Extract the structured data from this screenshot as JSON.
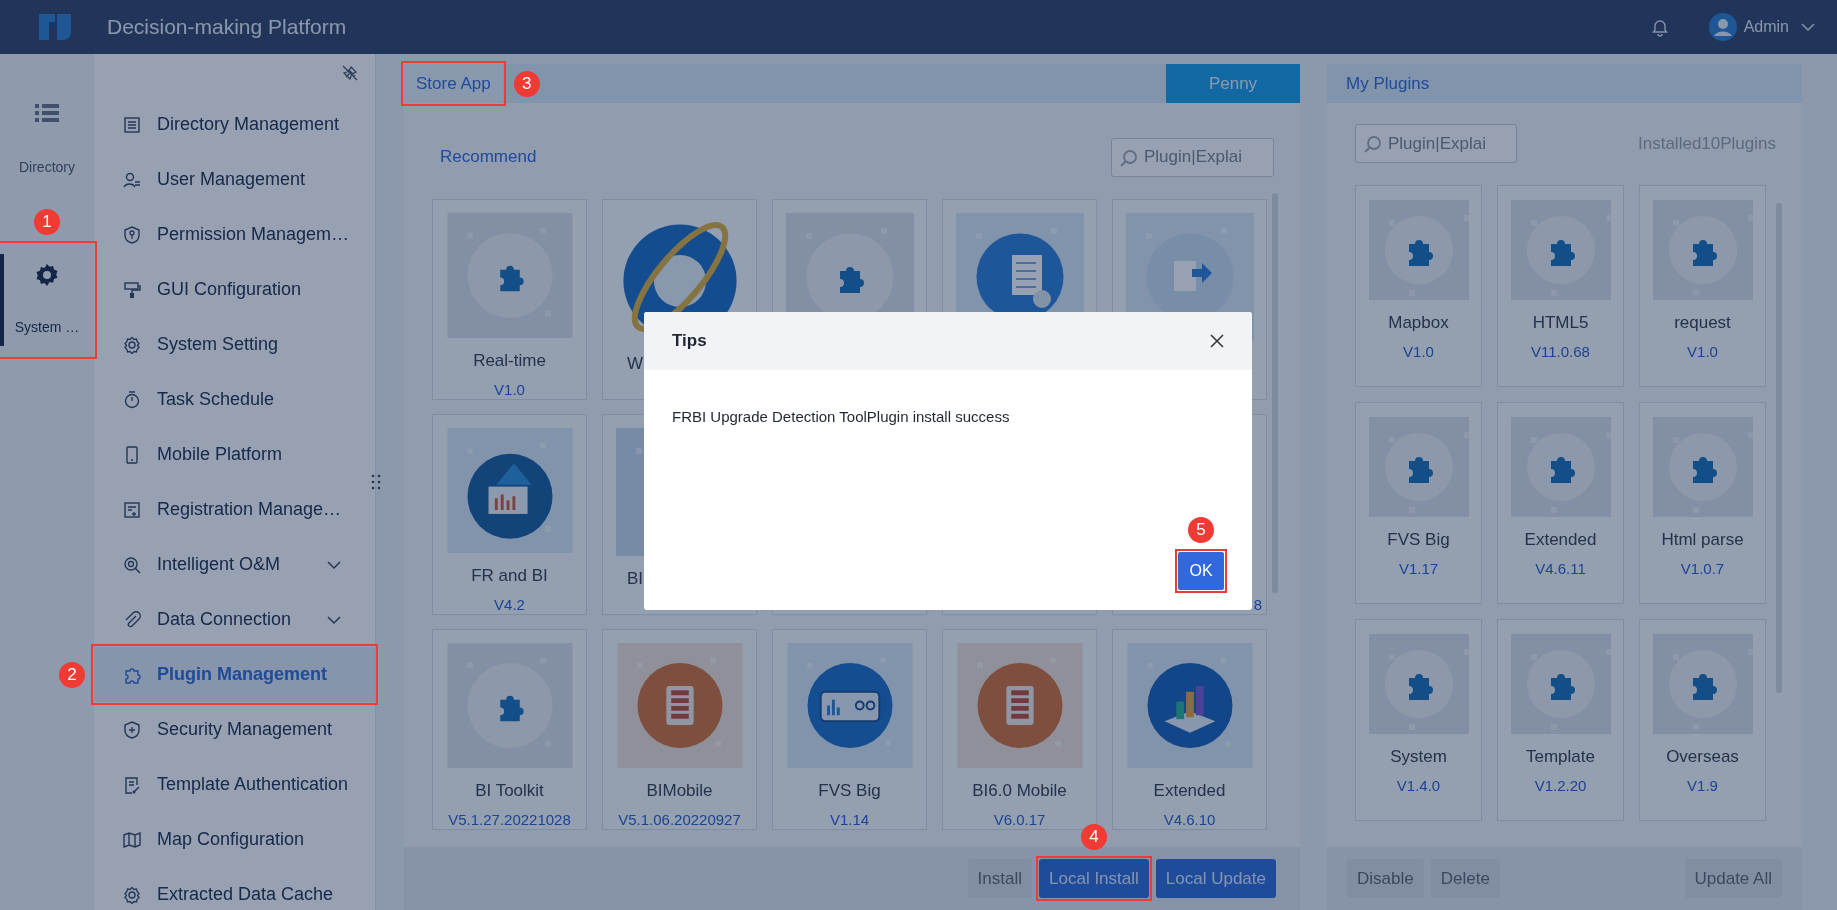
{
  "topbar": {
    "title": "Decision-making Platform",
    "user": "Admin"
  },
  "rail": [
    {
      "label": "Directory",
      "selected": false
    },
    {
      "label": "System …",
      "selected": true
    }
  ],
  "sidebar": {
    "items": [
      {
        "label": "Directory Management",
        "selected": false,
        "kind": "link"
      },
      {
        "label": "User Management",
        "selected": false,
        "kind": "link"
      },
      {
        "label": "Permission Managem…",
        "selected": false,
        "kind": "link"
      },
      {
        "label": "GUI Configuration",
        "selected": false,
        "kind": "link"
      },
      {
        "label": "System Setting",
        "selected": false,
        "kind": "link"
      },
      {
        "label": "Task Schedule",
        "selected": false,
        "kind": "link"
      },
      {
        "label": "Mobile Platform",
        "selected": false,
        "kind": "link"
      },
      {
        "label": "Registration Manage…",
        "selected": false,
        "kind": "link"
      },
      {
        "label": "Intelligent O&M",
        "selected": false,
        "kind": "group",
        "expanded": false
      },
      {
        "label": "Data Connection",
        "selected": false,
        "kind": "group",
        "expanded": false
      },
      {
        "label": "Plugin Management",
        "selected": true,
        "kind": "link"
      },
      {
        "label": "Security Management",
        "selected": false,
        "kind": "link"
      },
      {
        "label": "Template Authentication",
        "selected": false,
        "kind": "link"
      },
      {
        "label": "Map Configuration",
        "selected": false,
        "kind": "link"
      },
      {
        "label": "Extracted Data Cache",
        "selected": false,
        "kind": "link"
      }
    ]
  },
  "store": {
    "tab": "Store App",
    "user_button": "Penny",
    "section": "Recommend",
    "search": {
      "placeholder": "Plugin|Explai"
    },
    "cards": [
      {
        "kind": "puzzle",
        "name": "Real-time",
        "version": "V1.0"
      },
      {
        "kind": "browser",
        "name": "W",
        "covered_right": true
      },
      {
        "kind": "puzzle"
      },
      {
        "kind": "language"
      },
      {
        "kind": "document"
      },
      {
        "kind": "report",
        "name": "FR and BI",
        "version": "V4.2"
      },
      {
        "kind": "blank",
        "name": "BI",
        "covered_right": true
      },
      {
        "kind": "none"
      },
      {
        "kind": "none"
      },
      {
        "kind": "none",
        "version": "8",
        "covered_left": true
      },
      {
        "kind": "puzzle",
        "name": "BI Toolkit",
        "version": "V5.1.27.20221028"
      },
      {
        "kind": "mobile",
        "name": "BIMobile",
        "version": "V5.1.06.20220927"
      },
      {
        "kind": "dashboard",
        "name": "FVS Big",
        "version": "V1.14"
      },
      {
        "kind": "mobile",
        "name": "BI6.0 Mobile",
        "version": "V6.0.17"
      },
      {
        "kind": "chart",
        "name": "Extended",
        "version": "V4.6.10"
      }
    ],
    "buttons": [
      {
        "label": "Install",
        "disabled": true
      },
      {
        "label": "Local Install",
        "disabled": false
      },
      {
        "label": "Local Update",
        "disabled": false
      }
    ]
  },
  "plugins": {
    "title": "My Plugins",
    "search": {
      "placeholder": "Plugin|Explai"
    },
    "count": "Installed10Plugins",
    "cards": [
      {
        "name": "Mapbox",
        "version": "V1.0"
      },
      {
        "name": "HTML5",
        "version": "V11.0.68"
      },
      {
        "name": "request",
        "version": "V1.0"
      },
      {
        "name": "FVS Big",
        "version": "V1.17"
      },
      {
        "name": "Extended",
        "version": "V4.6.11"
      },
      {
        "name": "Html parse",
        "version": "V1.0.7"
      },
      {
        "name": "System",
        "version": "V1.4.0"
      },
      {
        "name": "Template",
        "version": "V1.2.20"
      },
      {
        "name": "Overseas",
        "version": "V1.9"
      }
    ],
    "buttons": [
      {
        "label": "Disable",
        "disabled": true
      },
      {
        "label": "Delete",
        "disabled": true
      },
      {
        "label": "Update All",
        "disabled": true
      }
    ]
  },
  "dialog": {
    "title": "Tips",
    "message": "FRBI Upgrade Detection ToolPlugin install success",
    "ok": "OK"
  },
  "annotations": [
    {
      "number": "1"
    },
    {
      "number": "2"
    },
    {
      "number": "3"
    },
    {
      "number": "4"
    },
    {
      "number": "5"
    }
  ]
}
